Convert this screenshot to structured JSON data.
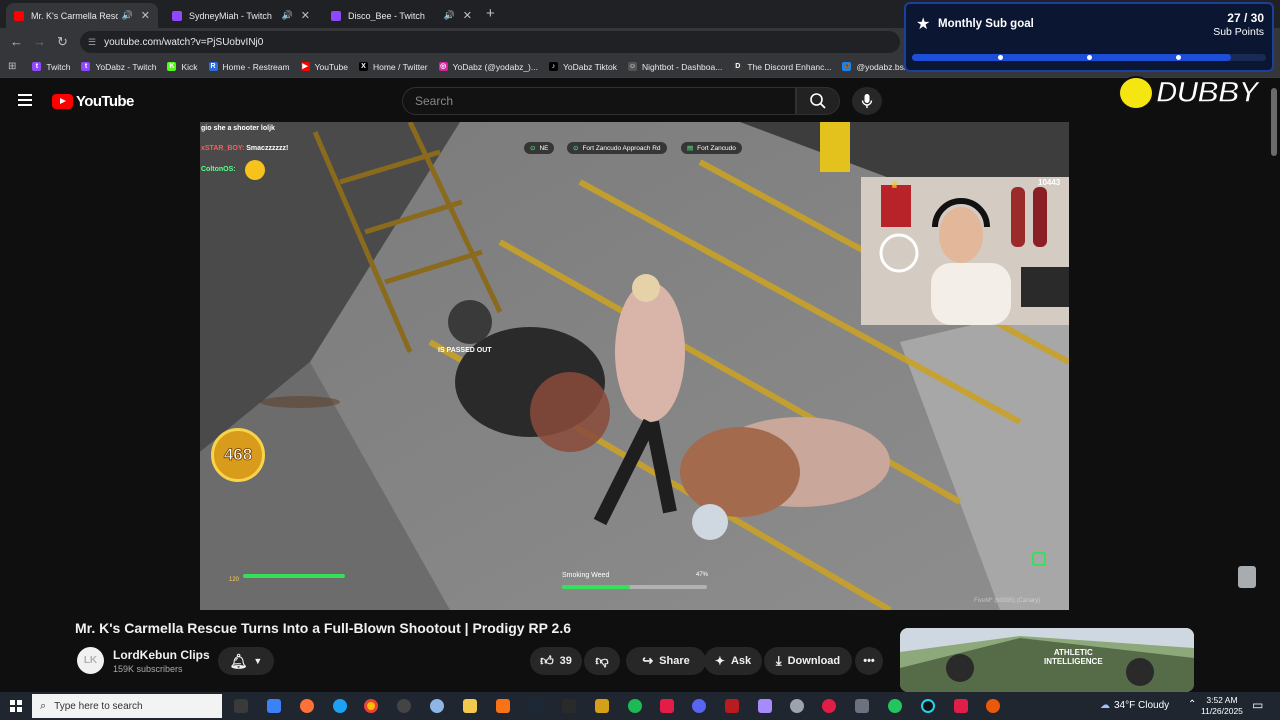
{
  "browser": {
    "tabs": [
      {
        "label": "Mr. K's Carmella Rescue Tu",
        "favicon_color": "#ff0000",
        "active": true
      },
      {
        "label": "SydneyMiah - Twitch",
        "favicon_color": "#9146ff",
        "active": false
      },
      {
        "label": "Disco_Bee - Twitch",
        "favicon_color": "#9146ff",
        "active": false
      }
    ],
    "new_tab_icon": "plus-icon",
    "url": "youtube.com/watch?v=PjSUobvINj0",
    "bookmarks": [
      {
        "label": "Twitch",
        "color": "#9146ff",
        "glyph": "t"
      },
      {
        "label": "YoDabz - Twitch",
        "color": "#9146ff",
        "glyph": "t"
      },
      {
        "label": "Kick",
        "color": "#53fc18",
        "glyph": "K"
      },
      {
        "label": "Home - Restream",
        "color": "#2d6cdf",
        "glyph": "R"
      },
      {
        "label": "YouTube",
        "color": "#ff0000",
        "glyph": "▶"
      },
      {
        "label": "Home / Twitter",
        "color": "#000000",
        "glyph": "X"
      },
      {
        "label": "YoDabz (@yodabz_)...",
        "color": "#d6249f",
        "glyph": "◎"
      },
      {
        "label": "YoDabz Tiktok",
        "color": "#000000",
        "glyph": "♪"
      },
      {
        "label": "Nightbot - Dashboa...",
        "color": "#555555",
        "glyph": "☺"
      },
      {
        "label": "The Discord Enhanc...",
        "color": "#3a3a3a",
        "glyph": "D"
      },
      {
        "label": "@yodabz.bsky.socia...",
        "color": "#1185fe",
        "glyph": "🦋"
      }
    ]
  },
  "sub_goal": {
    "title": "Monthly Sub goal",
    "count": "27 / 30",
    "unit": "Sub Points",
    "progress": 0.9
  },
  "youtube": {
    "logo_text": "YouTube",
    "search_placeholder": "Search",
    "video_title": "Mr. K's Carmella Rescue Turns Into a Full-Blown Shootout | Prodigy RP 2.6",
    "channel_name": "LordKebun Clips",
    "subscribers": "159K subscribers",
    "like_count": "39",
    "share_label": "Share",
    "ask_label": "Ask",
    "download_label": "Download",
    "recommended_overlay": "ATHLETIC\nINTELLIGENCE"
  },
  "dubby_logo": "DUBBY",
  "video": {
    "chat": [
      {
        "user": "",
        "text": "gio she a shooter loljk",
        "color": "#ffffff"
      },
      {
        "user": "xSTAR_BOY:",
        "text": "Smaczzzzzz!",
        "color": "#ff5b5b"
      },
      {
        "user": "ColtonOS:",
        "text": "",
        "color": "#5bff8a"
      }
    ],
    "gps": [
      "NE",
      "Fort Zancudo Approach Rd",
      "Fort Zancudo"
    ],
    "viewer_count": "10443",
    "coin_value": "468",
    "passed_out_text": "IS PASSED OUT",
    "action_label": "Smoking Weed",
    "action_percent": "47%",
    "action_progress": 0.47,
    "health_value": "120",
    "watermark": "FiveM* (b3095) (Canary)"
  },
  "taskbar": {
    "search_placeholder": "Type here to search",
    "weather": "34°F  Cloudy",
    "time": "3:52 AM",
    "date": "11/26/2025"
  }
}
